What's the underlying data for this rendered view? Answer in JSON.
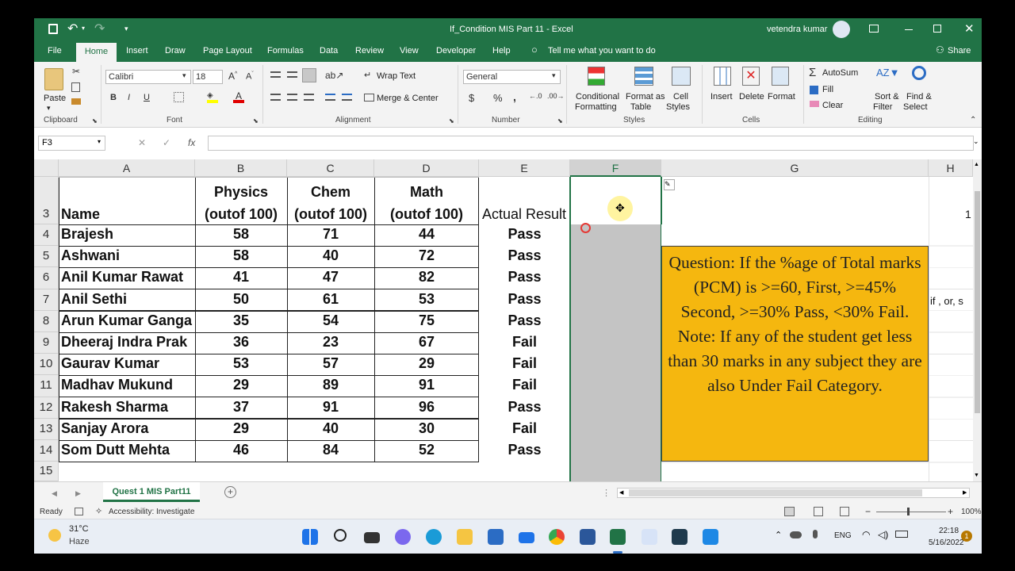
{
  "window": {
    "title": "If_Condition MIS Part 11  -  Excel",
    "user": "vetendra kumar"
  },
  "ribbon_tabs": [
    "File",
    "Home",
    "Insert",
    "Draw",
    "Page Layout",
    "Formulas",
    "Data",
    "Review",
    "View",
    "Developer",
    "Help"
  ],
  "tell_me": "Tell me what you want to do",
  "share": "Share",
  "clipboard": {
    "paste": "Paste",
    "label": "Clipboard"
  },
  "font": {
    "name": "Calibri",
    "size": "18",
    "label": "Font",
    "bold": "B",
    "italic": "I",
    "underline": "U"
  },
  "alignment": {
    "wrap": "Wrap Text",
    "merge": "Merge & Center",
    "label": "Alignment"
  },
  "number": {
    "format": "General",
    "label": "Number",
    "currency": "$",
    "percent": "%",
    "comma": ","
  },
  "styles": {
    "conditional": "Conditional",
    "conditional2": "Formatting",
    "format_as": "Format as",
    "format_as2": "Table",
    "cell": "Cell",
    "cell2": "Styles",
    "label": "Styles"
  },
  "cells": {
    "insert": "Insert",
    "delete": "Delete",
    "format": "Format",
    "label": "Cells"
  },
  "editing": {
    "autosum": "AutoSum",
    "fill": "Fill",
    "clear": "Clear",
    "sort": "Sort &",
    "sort2": "Filter",
    "find": "Find &",
    "find2": "Select",
    "label": "Editing"
  },
  "formula_bar": {
    "name_box": "F3",
    "fx": "fx",
    "cancel": "✕",
    "enter": "✓",
    "value": ""
  },
  "columns": [
    "A",
    "B",
    "C",
    "D",
    "E",
    "F",
    "G",
    "H"
  ],
  "headers": {
    "name": "Name",
    "physics1": "Physics",
    "physics2": "(outof 100)",
    "chem1": "Chem",
    "chem2": "(outof 100)",
    "math1": "Math",
    "math2": "(outof 100)",
    "result": "Actual Result",
    "h_partial": "1"
  },
  "rows": [
    {
      "row": "4",
      "name": "Brajesh",
      "physics": "58",
      "chem": "71",
      "math": "44",
      "result": "Pass"
    },
    {
      "row": "5",
      "name": "Ashwani",
      "physics": "58",
      "chem": "40",
      "math": "72",
      "result": "Pass"
    },
    {
      "row": "6",
      "name": "Anil Kumar Rawat",
      "physics": "41",
      "chem": "47",
      "math": "82",
      "result": "Pass"
    },
    {
      "row": "7",
      "name": "Anil Sethi",
      "physics": "50",
      "chem": "61",
      "math": "53",
      "result": "Pass"
    },
    {
      "row": "8",
      "name": "Arun Kumar Ganga",
      "physics": "35",
      "chem": "54",
      "math": "75",
      "result": "Pass"
    },
    {
      "row": "9",
      "name": "Dheeraj Indra Prak",
      "physics": "36",
      "chem": "23",
      "math": "67",
      "result": "Fail"
    },
    {
      "row": "10",
      "name": "Gaurav Kumar",
      "physics": "53",
      "chem": "57",
      "math": "29",
      "result": "Fail"
    },
    {
      "row": "11",
      "name": "Madhav Mukund",
      "physics": "29",
      "chem": "89",
      "math": "91",
      "result": "Fail"
    },
    {
      "row": "12",
      "name": "Rakesh Sharma",
      "physics": "37",
      "chem": "91",
      "math": "96",
      "result": "Pass"
    },
    {
      "row": "13",
      "name": "Sanjay Arora",
      "physics": "29",
      "chem": "40",
      "math": "30",
      "result": "Fail"
    },
    {
      "row": "14",
      "name": "Som Dutt Mehta",
      "physics": "46",
      "chem": "84",
      "math": "52",
      "result": "Pass"
    }
  ],
  "row_numbers": {
    "r3": "3",
    "r15": "15"
  },
  "question_box": "Question: If the %age of Total marks (PCM) is >=60, First, >=45% Second, >=30% Pass, <30% Fail.   Note: If any of the student get less than 30 marks in any subject they are also Under Fail Category.",
  "h7_partial": "if , or, s",
  "sheet_tab": "Quest 1 MIS Part11",
  "status": {
    "ready": "Ready",
    "accessibility": "Accessibility: Investigate",
    "zoom": "100%"
  },
  "taskbar": {
    "weather_temp": "31°C",
    "weather_desc": "Haze",
    "lang": "ENG",
    "time": "22:18",
    "date": "5/16/2022",
    "notif": "1"
  },
  "colors": {
    "excel_green": "#217346",
    "question_bg": "#f5b70f",
    "selection": "#c4c4c4"
  }
}
